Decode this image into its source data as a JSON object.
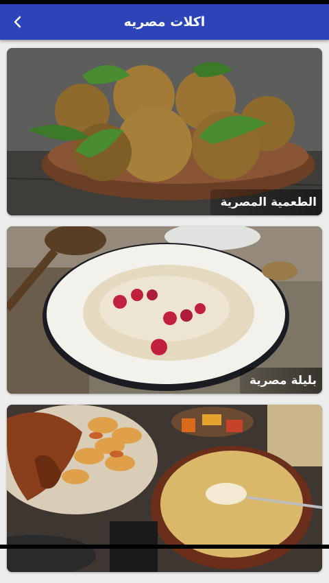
{
  "header": {
    "title": "اكلات مصريه",
    "back_icon": "chevron-left-icon"
  },
  "colors": {
    "appbar": "#2c44b8",
    "background": "#ececec"
  },
  "items": [
    {
      "label": "الطعمية المصرية"
    },
    {
      "label": "بليلة مصرية"
    },
    {
      "label": ""
    }
  ]
}
